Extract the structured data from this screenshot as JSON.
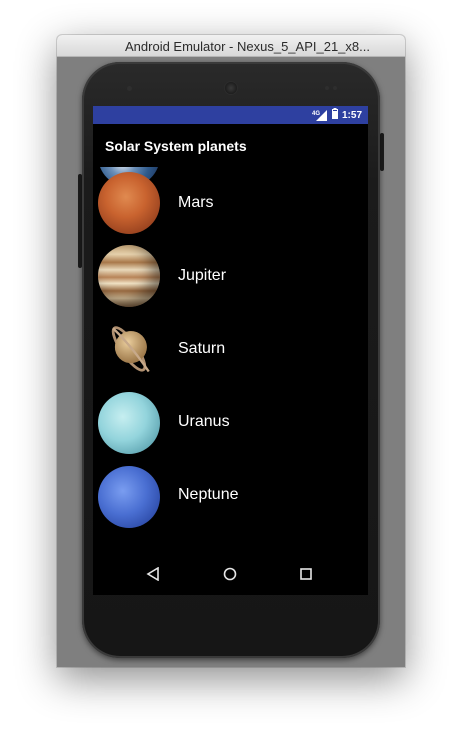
{
  "window": {
    "title": "Android Emulator - Nexus_5_API_21_x8..."
  },
  "status_bar": {
    "network": "4G",
    "time": "1:57",
    "color": "#2e40a0"
  },
  "app_bar": {
    "title": "Solar System planets"
  },
  "planets": [
    {
      "name": "",
      "icon": "earth-icon"
    },
    {
      "name": "Mars",
      "icon": "mars-icon"
    },
    {
      "name": "Jupiter",
      "icon": "jupiter-icon"
    },
    {
      "name": "Saturn",
      "icon": "saturn-icon"
    },
    {
      "name": "Uranus",
      "icon": "uranus-icon"
    },
    {
      "name": "Neptune",
      "icon": "neptune-icon"
    }
  ],
  "nav_bar": {
    "back_icon": "back-icon",
    "home_icon": "home-icon",
    "recents_icon": "recents-icon"
  }
}
